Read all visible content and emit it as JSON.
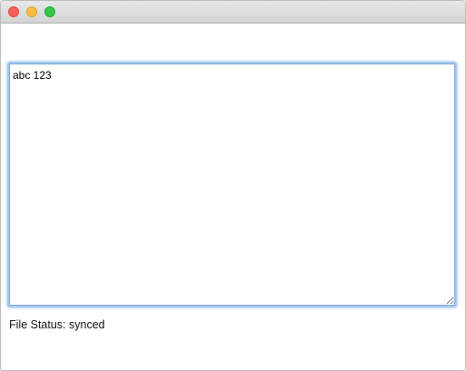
{
  "window": {
    "controls": [
      "close-icon",
      "minimize-icon",
      "zoom-icon"
    ],
    "colors": {
      "close": "#fc605b",
      "minimize": "#fdbc40",
      "zoom": "#34c84a",
      "focus_ring": "#7aa7d6"
    }
  },
  "editor": {
    "value": "abc 123"
  },
  "status": {
    "text": "File Status: synced"
  }
}
